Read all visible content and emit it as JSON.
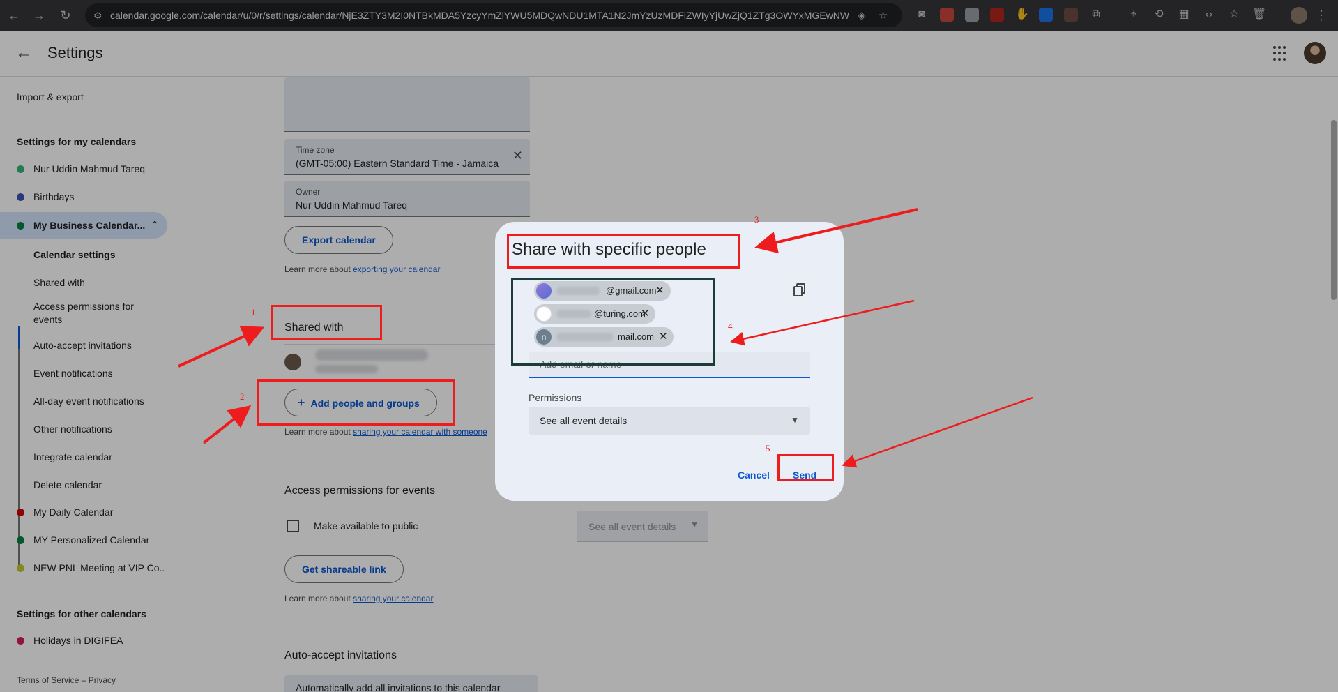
{
  "browser": {
    "url": "calendar.google.com/calendar/u/0/r/settings/calendar/NjE3ZTY3M2I0NTBkMDA5YzcyYmZlYWU5MDQwNDU1MTA1N2JmYzUzMDFiZWIyYjUwZjQ1ZTg3OWYxMGEwNWVk..."
  },
  "header": {
    "title": "Settings"
  },
  "sidebar": {
    "import_export": "Import & export",
    "my_calendars_heading": "Settings for my calendars",
    "calendars": [
      {
        "label": "Nur Uddin Mahmud Tareq",
        "color": "#33b679"
      },
      {
        "label": "Birthdays",
        "color": "#3f51b5"
      },
      {
        "label": "My Business Calendar...",
        "color": "#0b8043"
      }
    ],
    "subitems": [
      "Calendar settings",
      "Shared with",
      "Access permissions for events",
      "Auto-accept invitations",
      "Event notifications",
      "All-day event notifications",
      "Other notifications",
      "Integrate calendar",
      "Delete calendar"
    ],
    "more_calendars": [
      {
        "label": "My Daily Calendar",
        "color": "#d50000"
      },
      {
        "label": "MY Personalized Calendar",
        "color": "#0b8043"
      },
      {
        "label": "NEW PNL Meeting at VIP Co...",
        "color": "#c0ca33"
      }
    ],
    "other_calendars_heading": "Settings for other calendars",
    "other_calendars": [
      {
        "label": "Holidays in DIGIFEA",
        "color": "#d81b60"
      }
    ],
    "footer": "Terms of Service – Privacy"
  },
  "main": {
    "timezone": {
      "label": "Time zone",
      "value": "(GMT-05:00) Eastern Standard Time - Jamaica"
    },
    "owner": {
      "label": "Owner",
      "value": "Nur Uddin Mahmud Tareq"
    },
    "export_button": "Export calendar",
    "export_help_prefix": "Learn more about ",
    "export_help_link": "exporting your calendar",
    "shared_with_title": "Shared with",
    "add_people_button": "Add people and groups",
    "add_people_icon": "+",
    "sharing_help_prefix": "Learn more about ",
    "sharing_help_link": "sharing your calendar with someone",
    "access_title": "Access permissions for events",
    "public_label": "Make available to public",
    "public_select": "See all event details",
    "shareable_button": "Get shareable link",
    "shareable_help_prefix": "Learn more about ",
    "shareable_help_link": "sharing your calendar",
    "auto_accept_title": "Auto-accept invitations",
    "auto_accept_value": "Automatically add all invitations to this calendar"
  },
  "dialog": {
    "title": "Share with specific people",
    "chips": [
      {
        "initial": "",
        "visible_text": "@gmail.com",
        "avatar_color": "#7b7fd1"
      },
      {
        "initial": "",
        "visible_text": "@turing.com",
        "avatar_color": "#ffffff"
      },
      {
        "initial": "n",
        "visible_text": "mail.com",
        "avatar_color": "#6b7f8f"
      }
    ],
    "chip_remove": "✕",
    "add_placeholder": "Add email or name",
    "permissions_label": "Permissions",
    "permissions_value": "See all event details",
    "cancel": "Cancel",
    "send": "Send"
  },
  "annotations": {
    "labels": [
      "1",
      "2",
      "3",
      "4",
      "5"
    ],
    "color": "#ee1c1c"
  }
}
